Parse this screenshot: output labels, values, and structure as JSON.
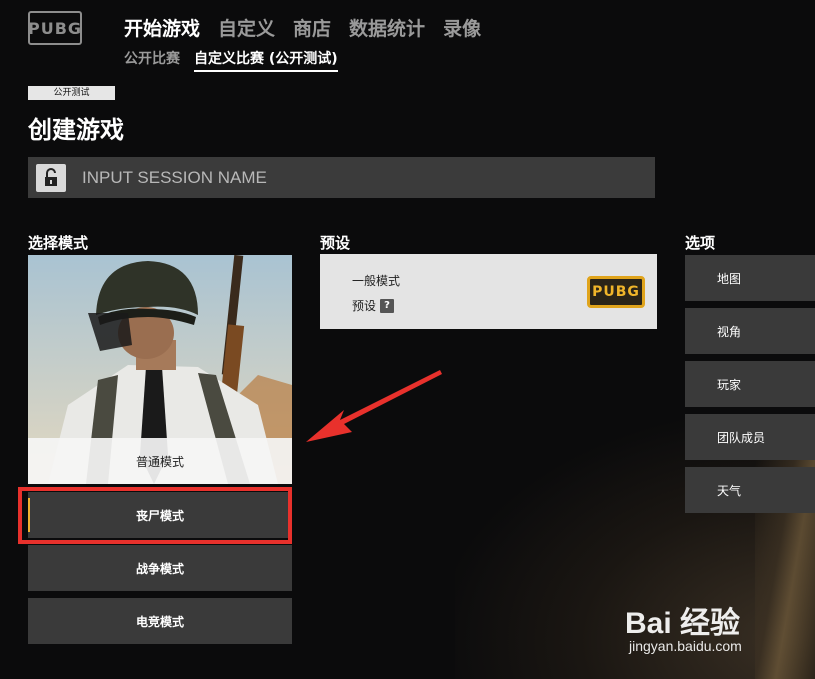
{
  "logo": "PUBG",
  "nav": {
    "items": [
      {
        "label": "开始游戏",
        "active": true
      },
      {
        "label": "自定义",
        "active": false
      },
      {
        "label": "商店",
        "active": false
      },
      {
        "label": "数据统计",
        "active": false
      },
      {
        "label": "录像",
        "active": false
      }
    ],
    "sub_items": [
      {
        "label": "公开比赛",
        "active": false
      },
      {
        "label": "自定义比赛 (公开测试)",
        "active": true
      }
    ]
  },
  "beta_badge": "公开测试",
  "page_title": "创建游戏",
  "session": {
    "placeholder": "INPUT SESSION NAME",
    "value": ""
  },
  "mode_section": {
    "label": "选择模式",
    "featured": "普通模式",
    "options": [
      "丧尸模式",
      "战争模式",
      "电竞模式"
    ],
    "selected": "丧尸模式"
  },
  "preset_section": {
    "label": "预设",
    "mode": "一般模式",
    "preset_label": "预设",
    "help": "?",
    "logo": "PUBG"
  },
  "options_section": {
    "label": "选项",
    "items": [
      "地图",
      "视角",
      "玩家",
      "团队成员",
      "天气"
    ]
  },
  "watermark": {
    "main": "Bai 经验",
    "url": "jingyan.baidu.com"
  },
  "colors": {
    "accent": "#f2b230",
    "highlight": "#e8312c",
    "panel": "#3a3a3a",
    "background": "#0b0b0c"
  }
}
